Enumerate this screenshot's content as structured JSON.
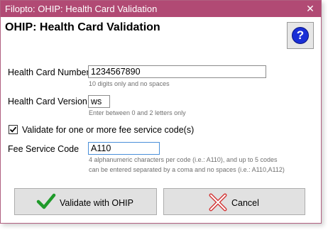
{
  "window": {
    "title": "Filopto: OHIP: Health Card Validation",
    "close_glyph": "✕"
  },
  "heading": "OHIP: Health Card Validation",
  "help_glyph": "?",
  "form": {
    "card_number": {
      "label": "Health Card Number",
      "value": "1234567890",
      "hint": "10 digits only and no spaces"
    },
    "card_version": {
      "label": "Health Card Version",
      "value": "ws",
      "hint": "Enter between 0 and 2 letters only"
    },
    "fee_check": {
      "label": "Validate for one or more fee service code(s)",
      "checked": true
    },
    "fee_code": {
      "label": "Fee Service Code",
      "value": "A110",
      "hint_line1": "4 alphanumeric characters per code (i.e.: A110), and up to 5 codes",
      "hint_line2": "can be entered separated by a coma and no spaces (i.e.: A110,A112)"
    }
  },
  "buttons": {
    "validate": {
      "label": "Validate with OHIP",
      "icon": "check-icon",
      "color": "#1f9a2a"
    },
    "cancel": {
      "label": "Cancel",
      "icon": "cancel-x-icon",
      "color": "#d33a3a"
    }
  },
  "colors": {
    "titlebar": "#b14a74",
    "help": "#1a2fd6"
  }
}
